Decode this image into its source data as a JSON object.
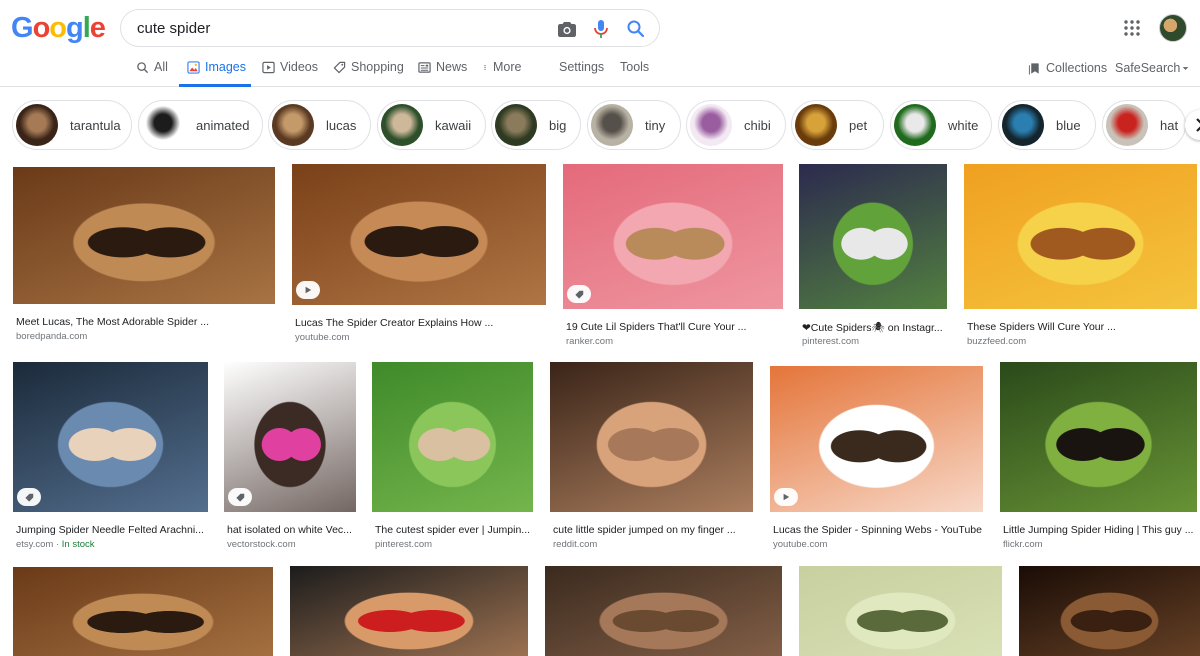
{
  "logo": {
    "letters": [
      "G",
      "o",
      "o",
      "g",
      "l",
      "e"
    ],
    "colors": [
      "#4285F4",
      "#EA4335",
      "#FBBC05",
      "#4285F4",
      "#34A853",
      "#EA4335"
    ]
  },
  "search": {
    "value": "cute spider"
  },
  "tabs": [
    {
      "label": "All",
      "icon": "search-icon"
    },
    {
      "label": "Images",
      "icon": "image-icon",
      "active": true
    },
    {
      "label": "Videos",
      "icon": "play-icon"
    },
    {
      "label": "Shopping",
      "icon": "tag-icon"
    },
    {
      "label": "News",
      "icon": "news-icon"
    },
    {
      "label": "More",
      "icon": "more-dots-icon"
    },
    {
      "label": "Settings"
    },
    {
      "label": "Tools"
    }
  ],
  "right_tools": {
    "collections": "Collections",
    "safesearch": "SafeSearch"
  },
  "chips": [
    {
      "label": "tarantula",
      "colors": [
        "#3a2418",
        "#a57a55"
      ]
    },
    {
      "label": "animated",
      "colors": [
        "#ffffff",
        "#1c1c1c"
      ]
    },
    {
      "label": "lucas",
      "colors": [
        "#5a3a22",
        "#c59a6a"
      ]
    },
    {
      "label": "kawaii",
      "colors": [
        "#2d4f2a",
        "#cdb89a"
      ]
    },
    {
      "label": "big",
      "colors": [
        "#2e3a22",
        "#8a7b5c"
      ]
    },
    {
      "label": "tiny",
      "colors": [
        "#b8b2a4",
        "#56504a"
      ]
    },
    {
      "label": "chibi",
      "colors": [
        "#f3e9f3",
        "#9a5ea0"
      ]
    },
    {
      "label": "pet",
      "colors": [
        "#6a3c0c",
        "#d8a23a"
      ]
    },
    {
      "label": "white",
      "colors": [
        "#1f6a1c",
        "#e9e9e9"
      ]
    },
    {
      "label": "blue",
      "colors": [
        "#14252e",
        "#2a7fb0"
      ]
    },
    {
      "label": "hat",
      "colors": [
        "#c9c2b8",
        "#c9231f"
      ]
    }
  ],
  "results": [
    {
      "title": "Meet Lucas, The Most Adorable Spider ...",
      "source": "boredpanda.com",
      "colors": [
        "#6a3a18",
        "#c08a55",
        "#2a1a10"
      ]
    },
    {
      "title": "Lucas The Spider Creator Explains How ...",
      "source": "youtube.com",
      "colors": [
        "#7a4018",
        "#c58a55",
        "#2b1a10"
      ],
      "badge": "play"
    },
    {
      "title": "19 Cute Lil Spiders That'll Cure Your ...",
      "source": "ranker.com",
      "colors": [
        "#e46a7a",
        "#f3a7b0",
        "#b98a5a"
      ],
      "badge": "tag"
    },
    {
      "title": "❤Cute Spiders🕷 on Instagr...",
      "source": "pinterest.com",
      "colors": [
        "#2c2a4e",
        "#61a23a",
        "#e8e8e8"
      ]
    },
    {
      "title": "These Spiders Will Cure Your ...",
      "source": "buzzfeed.com",
      "colors": [
        "#f0a020",
        "#f6d24a",
        "#a05a20"
      ]
    },
    {
      "title": "Jumping Spider Needle Felted Arachni...",
      "source": "etsy.com",
      "stock": "In stock",
      "colors": [
        "#1b2a3a",
        "#6a8ab0",
        "#e8d2bc"
      ],
      "badge": "tag"
    },
    {
      "title": "hat isolated on white Vec...",
      "source": "vectorstock.com",
      "colors": [
        "#ffffff",
        "#3c2a24",
        "#e040a0"
      ],
      "badge": "tag"
    },
    {
      "title": "The cutest spider ever | Jumpin...",
      "source": "pinterest.com",
      "colors": [
        "#3f8a2a",
        "#8ac65a",
        "#d9c0a0"
      ]
    },
    {
      "title": "cute little spider jumped on my finger ...",
      "source": "reddit.com",
      "colors": [
        "#3a2418",
        "#d8a27a",
        "#a8785a"
      ]
    },
    {
      "title": "Lucas the Spider - Spinning Webs - YouTube",
      "source": "youtube.com",
      "colors": [
        "#e4753a",
        "#ffffff",
        "#3a2a1e"
      ],
      "badge": "play"
    },
    {
      "title": "Little Jumping Spider Hiding | This guy ...",
      "source": "flickr.com",
      "colors": [
        "#2a4a1a",
        "#80b040",
        "#1a1410"
      ]
    },
    {
      "title": "",
      "source": "",
      "colors": [
        "#6a3a18",
        "#c08a55",
        "#2a1a10"
      ]
    },
    {
      "title": "",
      "source": "",
      "colors": [
        "#1c1c1c",
        "#d99a6a",
        "#cc1e1e"
      ]
    },
    {
      "title": "",
      "source": "",
      "colors": [
        "#3a2a1e",
        "#a5785a",
        "#6a4a30"
      ]
    },
    {
      "title": "",
      "source": "",
      "colors": [
        "#c8d0a0",
        "#e0e8c0",
        "#5a6a3a"
      ]
    },
    {
      "title": "",
      "source": "",
      "colors": [
        "#1a0c06",
        "#8a5a34",
        "#3a2010"
      ]
    }
  ]
}
